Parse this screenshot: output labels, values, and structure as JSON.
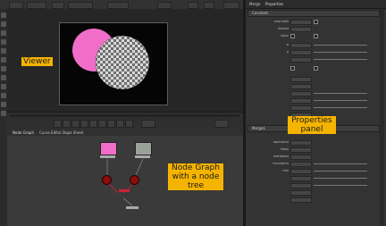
{
  "annotations": {
    "viewer": "Viewer",
    "properties": "Properties panel",
    "node_graph": "Node Graph with a node tree"
  },
  "node_graph": {
    "tabs": [
      "Node Graph",
      "Curve Editor",
      "Dope Sheet"
    ]
  },
  "properties": {
    "panel_tabs": [
      "Merge",
      "Properties"
    ],
    "upper_node_title": "Constant",
    "lower_node_title": "Merge1",
    "upper_rows": [
      "channels",
      "format",
      "color",
      "a",
      "a"
    ],
    "lower_rows": [
      "operation",
      "bbox",
      "metadata",
      "transform",
      "mix"
    ]
  },
  "colors": {
    "annotation": "#f5b400",
    "pink_circle": "#f06ec8",
    "node_red": "#8a0d0d",
    "viewer_bg": "#050505"
  },
  "icons": [
    "checkerboard-sphere",
    "pink-circle",
    "red-node-icon",
    "merge-node-icon"
  ]
}
